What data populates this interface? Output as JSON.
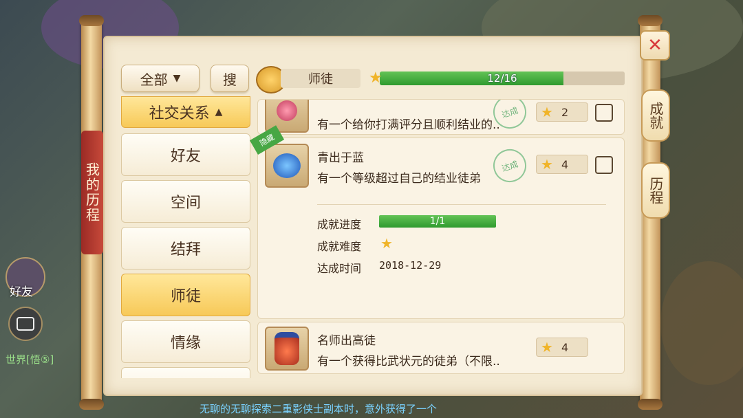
{
  "filter": {
    "label": "全部",
    "search_label": "搜"
  },
  "progress_header": {
    "category": "师徒",
    "value": 12,
    "total": 16,
    "text": "12/16"
  },
  "sidebar": {
    "section_label": "社交关系",
    "items": [
      {
        "label": "好友"
      },
      {
        "label": "空间"
      },
      {
        "label": "结拜"
      },
      {
        "label": "师徒"
      },
      {
        "label": "情缘"
      }
    ]
  },
  "left_banner": "我的历程",
  "right_tabs": {
    "achievement": "成就",
    "history": "历程"
  },
  "achievements": [
    {
      "desc": "有一个给你打满评分且顺利结业的..",
      "stamp": "达成",
      "score": "2"
    },
    {
      "title": "青出于蓝",
      "desc": "有一个等级超过自己的结业徒弟",
      "stamp": "达成",
      "badge": "隐藏",
      "score": "4"
    },
    {
      "title": "名师出高徒",
      "desc": "有一个获得比武状元的徒弟（不限..",
      "score": "4"
    }
  ],
  "detail": {
    "progress_label": "成就进度",
    "progress_value": 1,
    "progress_total": 1,
    "progress_text": "1/1",
    "difficulty_label": "成就难度",
    "difficulty_stars": 1,
    "date_label": "达成时间",
    "date_value": "2018-12-29"
  },
  "hud": {
    "friend_label": "好友",
    "channel": "世界",
    "channel_tag": "[悟⑤]",
    "ticker": "无聊的无聊探索二重影侠士副本时，意外获得了一个"
  },
  "colors": {
    "accent": "#3fa63c",
    "close": "#d8393a",
    "paper": "#f4ead3"
  }
}
